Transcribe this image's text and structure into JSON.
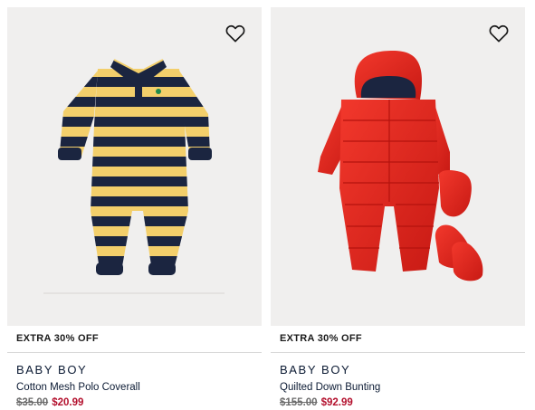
{
  "products": [
    {
      "promo": "EXTRA 30% OFF",
      "category": "BABY BOY",
      "name": "Cotton Mesh Polo Coverall",
      "original_price": "$35.00",
      "sale_price": "$20.99",
      "wishlist_icon": "heart-outline-icon",
      "colors": {
        "stripe_a": "#f3cf6b",
        "stripe_b": "#1b2540",
        "logo": "#1f8a4c"
      }
    },
    {
      "promo": "EXTRA 30% OFF",
      "category": "BABY BOY",
      "name": "Quilted Down Bunting",
      "original_price": "$155.00",
      "sale_price": "$92.99",
      "wishlist_icon": "heart-outline-icon",
      "colors": {
        "fabric": "#e3261d",
        "lining": "#1b2540"
      }
    }
  ],
  "colors": {
    "sale": "#b3102d",
    "strike": "#6b6b6b",
    "image_bg": "#f0efee"
  }
}
